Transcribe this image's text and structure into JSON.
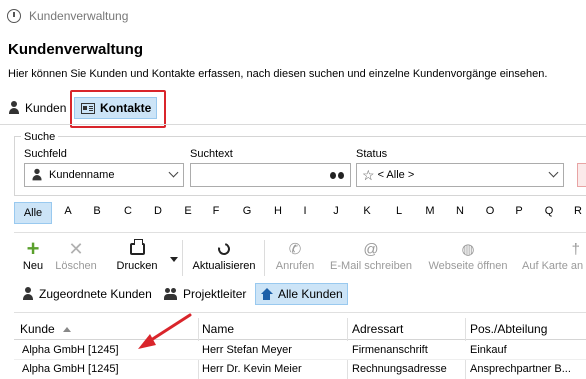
{
  "window": {
    "title": "Kundenverwaltung"
  },
  "header": {
    "title": "Kundenverwaltung",
    "subtitle": "Hier können Sie Kunden und Kontakte erfassen, nach diesen suchen und einzelne Kundenvorgänge einsehen."
  },
  "tabs": [
    {
      "label": "Kunden",
      "icon": "person-icon",
      "active": false
    },
    {
      "label": "Kontakte",
      "icon": "contact-card-icon",
      "active": true
    }
  ],
  "search": {
    "legend": "Suche",
    "field_label": "Suchfeld",
    "field_value": "Kundenname",
    "text_label": "Suchtext",
    "text_value": "",
    "status_label": "Status",
    "status_value": "< Alle >"
  },
  "alphabet": [
    "Alle",
    "A",
    "B",
    "C",
    "D",
    "E",
    "F",
    "G",
    "H",
    "I",
    "J",
    "K",
    "L",
    "M",
    "N",
    "O",
    "P",
    "Q",
    "R"
  ],
  "toolbar": {
    "neu": "Neu",
    "loeschen": "Löschen",
    "drucken": "Drucken",
    "aktualisieren": "Aktualisieren",
    "anrufen": "Anrufen",
    "email": "E-Mail schreiben",
    "webseite": "Webseite öffnen",
    "karte": "Auf Karte an"
  },
  "filters": {
    "zugeordnete": "Zugeordnete Kunden",
    "projektleiter": "Projektleiter",
    "alle": "Alle Kunden"
  },
  "table": {
    "columns": [
      "Kunde",
      "Name",
      "Adressart",
      "Pos./Abteilung"
    ],
    "rows": [
      [
        "Alpha GmbH [1245]",
        "Herr Stefan Meyer",
        "Firmenanschrift",
        "Einkauf"
      ],
      [
        "Alpha GmbH [1245]",
        "Herr Dr. Kevin Meier",
        "Rechnungsadresse",
        "Ansprechpartner B..."
      ]
    ]
  },
  "colors": {
    "highlight": "#d9252b",
    "selected_bg": "#cce4f7",
    "selected_border": "#99c9ef",
    "green_plus": "#5aa02c"
  }
}
